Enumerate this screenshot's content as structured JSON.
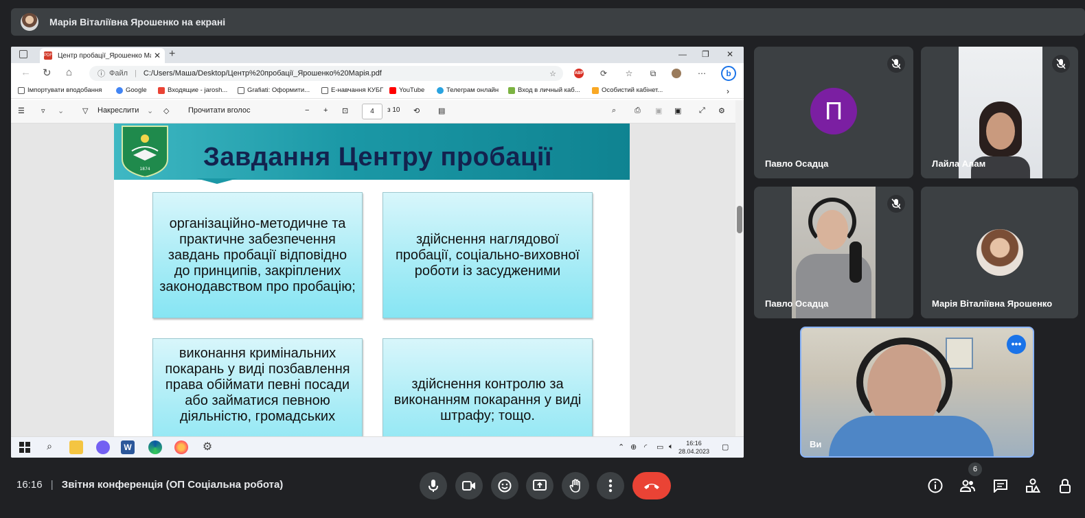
{
  "banner": {
    "presenter_text": "Марія Віталіївна Ярошенко на екрані"
  },
  "browser": {
    "tab_title": "Центр пробації_Ярошенко Мар",
    "url_prefix": "Файл",
    "url": "C:/Users/Маша/Desktop/Центр%20пробації_Ярошенко%20Марія.pdf",
    "bookmarks": [
      "Імпортувати вподобання",
      "Google",
      "Входящие - jarosh...",
      "Grafiati: Оформити...",
      "E-навчання КУБГ",
      "YouTube",
      "Телеграм онлайн",
      "Вход в личный каб...",
      "Особистий кабінет..."
    ]
  },
  "pdf_toolbar": {
    "draw_label": "Накреслити",
    "read_aloud_label": "Прочитати вголос",
    "page_current": "4",
    "page_total": "з 10"
  },
  "slide": {
    "title": "Завдання Центру пробації",
    "crest_year": "1874",
    "boxes": [
      "організаційно-методичне та практичне забезпечення завдань пробації відповідно до принципів, закріплених законодавством про пробацію;",
      "здійснення наглядової пробації, соціально-виховної роботи із засудженими",
      "виконання кримінальних покарань у виді позбавлення права обіймати певні посади або займатися певною діяльністю, громадських",
      "здійснення контролю за виконанням покарання у виді штрафу; тощо."
    ]
  },
  "taskbar": {
    "time": "16:16",
    "date": "28.04.2023"
  },
  "participants": [
    {
      "name": "Павло Осадца",
      "avatar_letter": "П",
      "avatar_color": "#7b1fa2",
      "muted": true
    },
    {
      "name": "Лайла Алам",
      "muted": true
    },
    {
      "name": "Павло Осадца",
      "muted": true
    },
    {
      "name": "Марія Віталіївна Ярошенко",
      "muted": false
    }
  ],
  "self": {
    "label": "Ви"
  },
  "meeting": {
    "time": "16:16",
    "title": "Звітня конференція (ОП Соціальна робота)",
    "people_count": "6"
  },
  "colors": {
    "end_call": "#ea4335",
    "background": "#202124",
    "tile": "#3c4043",
    "self_border": "#8ab4f8"
  }
}
